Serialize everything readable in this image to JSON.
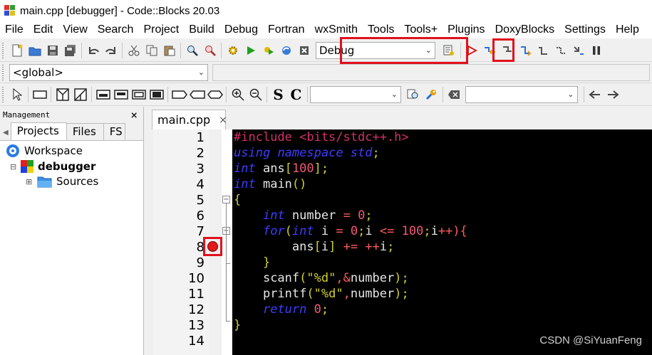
{
  "window": {
    "title": "main.cpp [debugger] - Code::Blocks 20.03"
  },
  "menu": [
    "File",
    "Edit",
    "View",
    "Search",
    "Project",
    "Build",
    "Debug",
    "Fortran",
    "wxSmith",
    "Tools",
    "Tools+",
    "Plugins",
    "DoxyBlocks",
    "Settings",
    "Help"
  ],
  "toolbar": {
    "build_target": "Debug",
    "scope": "<global>",
    "code_completion_left": "",
    "code_completion_right": "",
    "font_buttons": {
      "serif_s": "S",
      "serif_c": "C"
    }
  },
  "management": {
    "title": "Management",
    "close_glyph": "×",
    "tabs": [
      "Projects",
      "Files",
      "FS"
    ],
    "tree": {
      "workspace": "Workspace",
      "project": "debugger",
      "folder": "Sources"
    }
  },
  "editor": {
    "tab_label": "main.cpp",
    "tab_close": "×",
    "line_numbers": [
      "1",
      "2",
      "3",
      "4",
      "5",
      "6",
      "7",
      "8",
      "9",
      "10",
      "11",
      "12",
      "13",
      "14"
    ],
    "breakpoint_line": 8,
    "code_lines": [
      "#include <bits/stdc++.h>",
      "using namespace std;",
      "int ans[100];",
      "int main()",
      "{",
      "    int number = 0;",
      "    for(int i = 0;i <= 100;i++){",
      "        ans[i] += ++i;",
      "    }",
      "    scanf(\"%d\",&number);",
      "    printf(\"%d\",number);",
      "    return 0;",
      "}",
      ""
    ]
  },
  "watermark": "CSDN @SiYuanFeng",
  "colors": {
    "highlight_box": "#e1111d",
    "editor_bg": "#000000",
    "keyword": "#3d3dff",
    "preprocessor": "#d0306a",
    "number": "#f05a7a",
    "string": "#cfcf2f"
  }
}
